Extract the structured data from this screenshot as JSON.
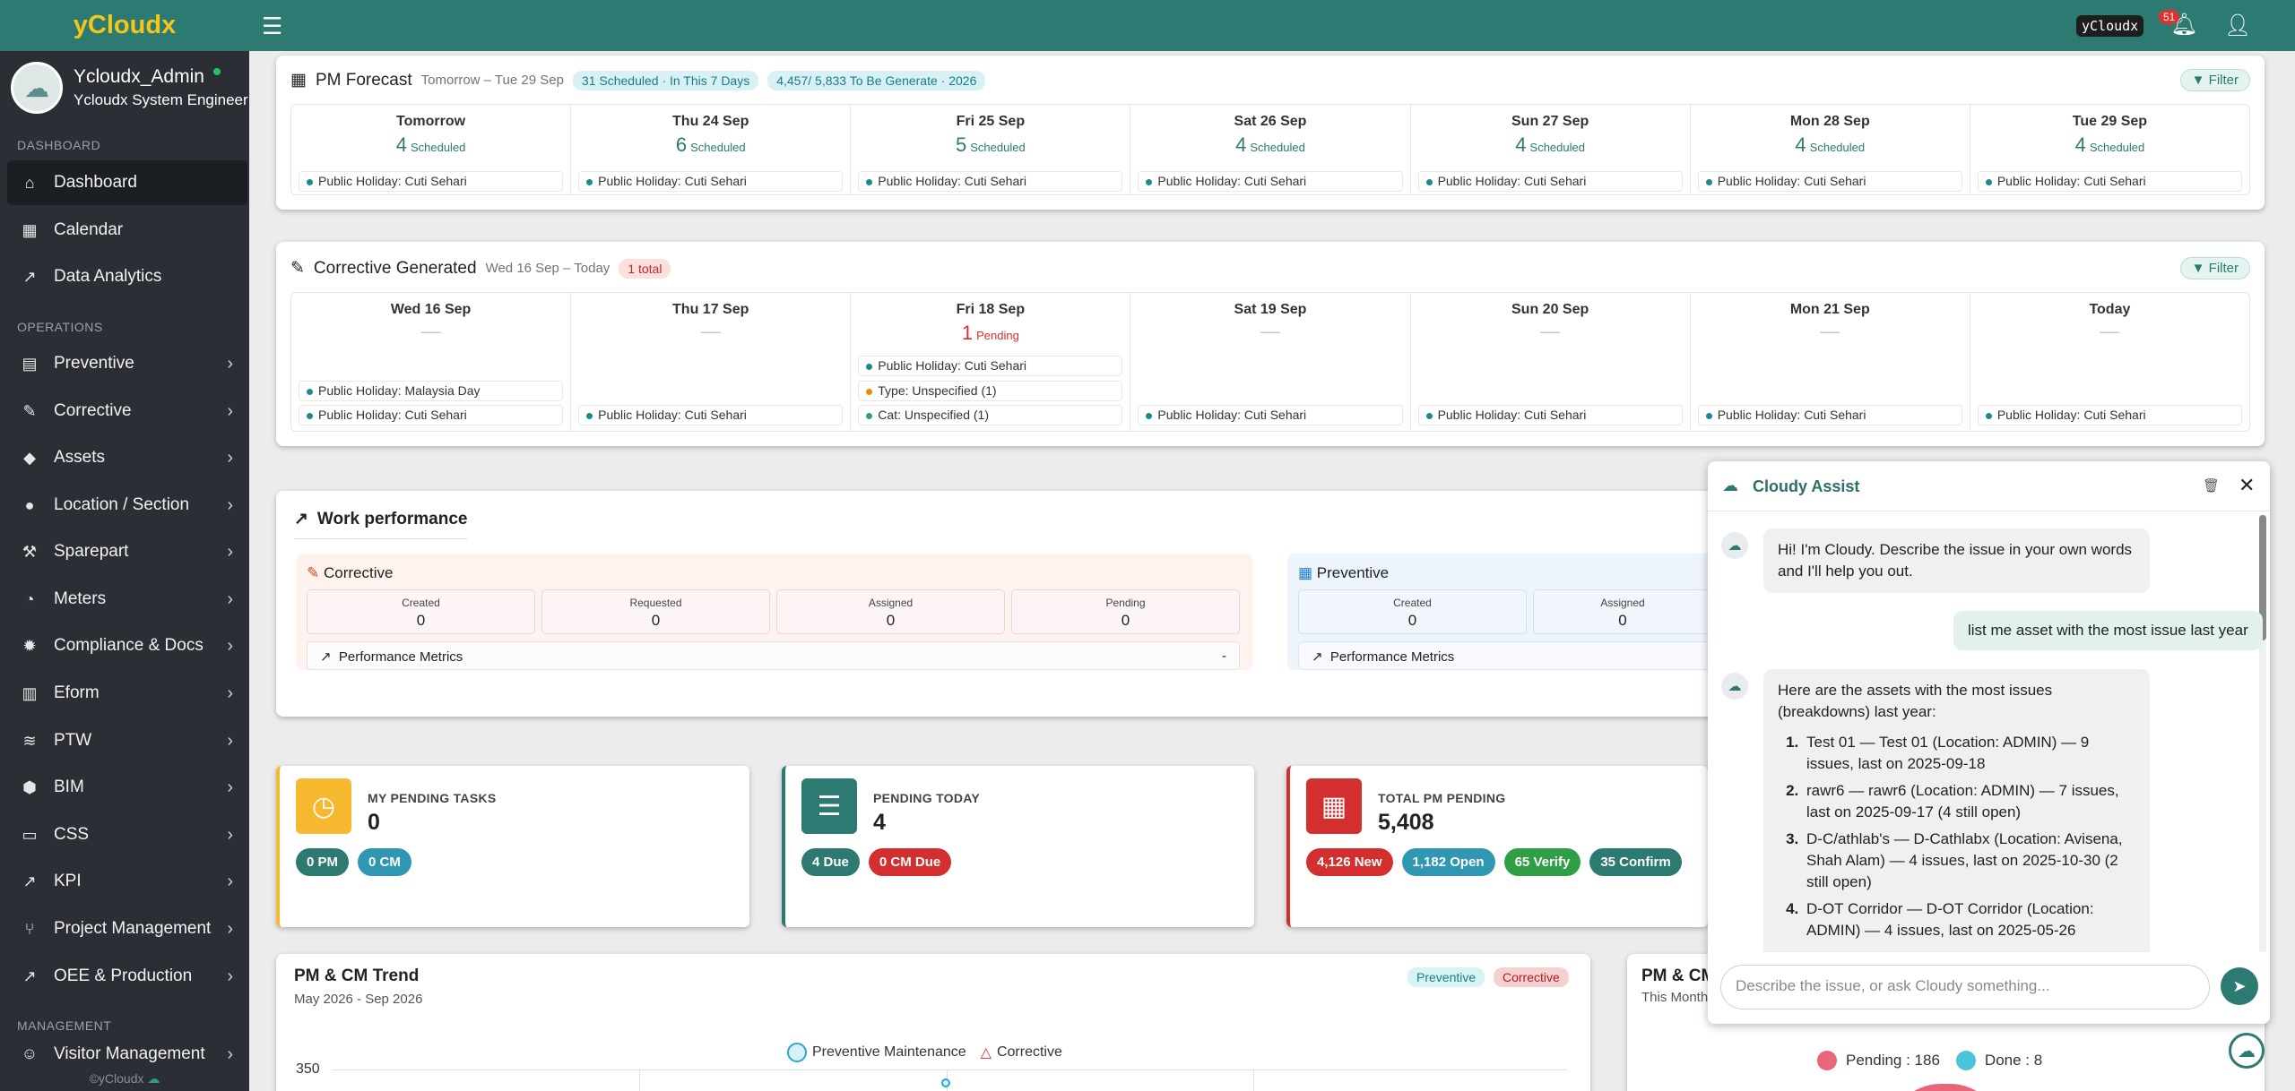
{
  "brand": "yCloudx",
  "user": {
    "name": "Ycloudx_Admin",
    "role": "Ycloudx System Engineer"
  },
  "sections": {
    "dashboard": "DASHBOARD",
    "operations": "OPERATIONS",
    "management": "MANAGEMENT"
  },
  "nav": [
    {
      "label": "Dashboard",
      "icon": "home-icon"
    },
    {
      "label": "Calendar",
      "icon": "calendar-icon"
    },
    {
      "label": "Data Analytics",
      "icon": "chart-line-icon"
    },
    {
      "label": "Preventive",
      "icon": "toolbox-icon"
    },
    {
      "label": "Corrective",
      "icon": "wrench-icon"
    },
    {
      "label": "Assets",
      "icon": "tag-icon"
    },
    {
      "label": "Location / Section",
      "icon": "globe-icon"
    },
    {
      "label": "Sparepart",
      "icon": "tools-icon"
    },
    {
      "label": "Meters",
      "icon": "gauge-icon"
    },
    {
      "label": "Compliance & Docs",
      "icon": "badge-icon"
    },
    {
      "label": "Eform",
      "icon": "form-icon"
    },
    {
      "label": "PTW",
      "icon": "database-icon"
    },
    {
      "label": "BIM",
      "icon": "cube-icon"
    },
    {
      "label": "CSS",
      "icon": "monitor-icon"
    },
    {
      "label": "KPI",
      "icon": "chart-line-icon"
    },
    {
      "label": "Project Management",
      "icon": "branch-icon"
    },
    {
      "label": "OEE & Production",
      "icon": "chart-area-icon"
    },
    {
      "label": "Visitor Management",
      "icon": "user-icon"
    }
  ],
  "footer": "©yCloudx",
  "topbar": {
    "brand_tag": "yCloudx",
    "notif_count": "51"
  },
  "forecast": {
    "title": "PM Forecast",
    "range": "Tomorrow – Tue 29 Sep",
    "pill1": "31 Scheduled · In This 7 Days",
    "pill2": "4,457/ 5,833 To Be Generate · 2026",
    "filter": "Filter",
    "days": [
      {
        "h": "Tomorrow",
        "n": "4",
        "s": "Scheduled",
        "tag": "Public Holiday: Cuti Sehari"
      },
      {
        "h": "Thu 24 Sep",
        "n": "6",
        "s": "Scheduled",
        "tag": "Public Holiday: Cuti Sehari"
      },
      {
        "h": "Fri 25 Sep",
        "n": "5",
        "s": "Scheduled",
        "tag": "Public Holiday: Cuti Sehari"
      },
      {
        "h": "Sat 26 Sep",
        "n": "4",
        "s": "Scheduled",
        "tag": "Public Holiday: Cuti Sehari"
      },
      {
        "h": "Sun 27 Sep",
        "n": "4",
        "s": "Scheduled",
        "tag": "Public Holiday: Cuti Sehari"
      },
      {
        "h": "Mon 28 Sep",
        "n": "4",
        "s": "Scheduled",
        "tag": "Public Holiday: Cuti Sehari"
      },
      {
        "h": "Tue 29 Sep",
        "n": "4",
        "s": "Scheduled",
        "tag": "Public Holiday: Cuti Sehari"
      }
    ]
  },
  "corrective_gen": {
    "title": "Corrective Generated",
    "range": "Wed 16 Sep – Today",
    "pill": "1 total",
    "filter": "Filter",
    "days": [
      {
        "h": "Wed 16 Sep",
        "dash": "—",
        "tag_a": "Public Holiday: Malaysia Day",
        "tag": "Public Holiday: Cuti Sehari"
      },
      {
        "h": "Thu 17 Sep",
        "dash": "—",
        "tag": "Public Holiday: Cuti Sehari"
      },
      {
        "h": "Fri 18 Sep",
        "n": "1",
        "s": "Pending",
        "tag_top": "Public Holiday: Cuti Sehari",
        "tag_type": "Type: Unspecified (1)",
        "tag_cat": "Cat: Unspecified (1)"
      },
      {
        "h": "Sat 19 Sep",
        "dash": "—",
        "tag": "Public Holiday: Cuti Sehari"
      },
      {
        "h": "Sun 20 Sep",
        "dash": "—",
        "tag": "Public Holiday: Cuti Sehari"
      },
      {
        "h": "Mon 21 Sep",
        "dash": "—",
        "tag": "Public Holiday: Cuti Sehari"
      },
      {
        "h": "Today",
        "dash": "—",
        "tag": "Public Holiday: Cuti Sehari"
      }
    ]
  },
  "work": {
    "title": "Work performance",
    "corrective": {
      "title": "Corrective",
      "stats": [
        {
          "l": "Created",
          "v": "0"
        },
        {
          "l": "Requested",
          "v": "0"
        },
        {
          "l": "Assigned",
          "v": "0"
        },
        {
          "l": "Pending",
          "v": "0"
        }
      ],
      "metrics": "Performance Metrics",
      "metrics_toggle": "-"
    },
    "preventive": {
      "title": "Preventive",
      "stats": [
        {
          "l": "Created",
          "v": "0"
        },
        {
          "l": "Assigned",
          "v": "0"
        }
      ],
      "metrics": "Performance Metrics"
    }
  },
  "tiles": [
    {
      "title": "MY PENDING TASKS",
      "value": "0",
      "chips": [
        "0 PM",
        "0 CM"
      ]
    },
    {
      "title": "PENDING TODAY",
      "value": "4",
      "chips": [
        "4 Due",
        "0 CM Due"
      ]
    },
    {
      "title": "TOTAL PM PENDING",
      "value": "5,408",
      "chips": [
        "4,126 New",
        "1,182 Open",
        "65 Verify",
        "35 Confirm"
      ]
    }
  ],
  "trend": {
    "title": "PM & CM Trend",
    "range": "May 2026 - Sep 2026",
    "pill_pm": "Preventive",
    "pill_cm": "Corrective",
    "legend_pm": "Preventive Maintenance",
    "legend_cm": "Corrective",
    "y_top": "350"
  },
  "pmcm": {
    "title": "PM & CM",
    "sub": "This Month",
    "pending": "Pending : 186",
    "done": "Done : 8"
  },
  "chat": {
    "title": "Cloudy Assist",
    "bot1": "Hi! I'm Cloudy. Describe the issue in your own words and I'll help you out.",
    "user1": "list me asset with the most issue last year",
    "bot2_intro": "Here are the assets with the most issues (breakdowns) last year:",
    "items": [
      "Test 01 — Test 01 (Location: ADMIN) — 9 issues, last on 2025-09-18",
      "rawr6 — rawr6 (Location: ADMIN) — 7 issues, last on 2025-09-17 (4 still open)",
      "D-C/athlab's — D-Cathlabx (Location: Avisena, Shah Alam) — 4 issues, last on 2025-10-30 (2 still open)",
      "D-OT Corridor — D-OT Corridor (Location: ADMIN) — 4 issues, last on 2025-05-26"
    ],
    "placeholder": "Describe the issue, or ask Cloudy something..."
  }
}
